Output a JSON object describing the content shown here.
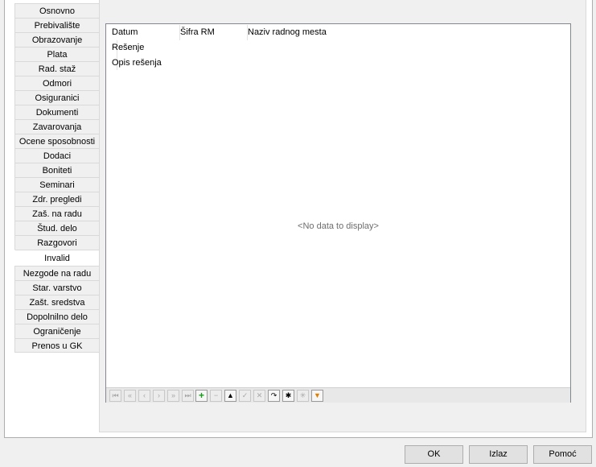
{
  "tabs": [
    {
      "label": "Osnovno",
      "active": false
    },
    {
      "label": "Prebivalište",
      "active": false
    },
    {
      "label": "Obrazovanje",
      "active": false
    },
    {
      "label": "Plata",
      "active": false
    },
    {
      "label": "Rad. staž",
      "active": false
    },
    {
      "label": "Odmori",
      "active": false
    },
    {
      "label": "Osiguranici",
      "active": false
    },
    {
      "label": "Dokumenti",
      "active": false
    },
    {
      "label": "Zavarovanja",
      "active": false
    },
    {
      "label": "Ocene sposobnosti",
      "active": false
    },
    {
      "label": "Dodaci",
      "active": false
    },
    {
      "label": "Boniteti",
      "active": false
    },
    {
      "label": "Seminari",
      "active": false
    },
    {
      "label": "Zdr. pregledi",
      "active": false
    },
    {
      "label": "Zaš. na radu",
      "active": false
    },
    {
      "label": "Štud. delo",
      "active": false
    },
    {
      "label": "Razgovori",
      "active": false
    },
    {
      "label": "Invalid",
      "active": true
    },
    {
      "label": "Nezgode na radu",
      "active": false
    },
    {
      "label": "Star. varstvo",
      "active": false
    },
    {
      "label": "Zašt. sredstva",
      "active": false
    },
    {
      "label": "Dopolnilno delo",
      "active": false
    },
    {
      "label": "Ograničenje",
      "active": false
    },
    {
      "label": "Prenos u GK",
      "active": false
    }
  ],
  "grid": {
    "columns": [
      "Datum",
      "Šifra RM",
      "Naziv radnog mesta"
    ],
    "row2_label": "Rešenje",
    "row3_label": "Opis rešenja",
    "empty_text": "<No data to display>"
  },
  "navigator": [
    {
      "icon": "first-icon",
      "glyph": "⏮",
      "enabled": false
    },
    {
      "icon": "prev-page-icon",
      "glyph": "«",
      "enabled": false
    },
    {
      "icon": "prev-icon",
      "glyph": "‹",
      "enabled": false
    },
    {
      "icon": "next-icon",
      "glyph": "›",
      "enabled": false
    },
    {
      "icon": "next-page-icon",
      "glyph": "»",
      "enabled": false
    },
    {
      "icon": "last-icon",
      "glyph": "⏭",
      "enabled": false
    },
    {
      "icon": "append-icon",
      "glyph": "+",
      "enabled": true
    },
    {
      "icon": "delete-icon",
      "glyph": "−",
      "enabled": false
    },
    {
      "icon": "edit-icon",
      "glyph": "▲",
      "enabled": true
    },
    {
      "icon": "post-icon",
      "glyph": "✓",
      "enabled": false
    },
    {
      "icon": "cancel-icon",
      "glyph": "✕",
      "enabled": false
    },
    {
      "icon": "refresh-icon",
      "glyph": "↷",
      "enabled": true
    },
    {
      "icon": "save-bookmark-icon",
      "glyph": "✱",
      "enabled": true
    },
    {
      "icon": "goto-bookmark-icon",
      "glyph": "✳",
      "enabled": false
    },
    {
      "icon": "filter-icon",
      "glyph": "▼",
      "enabled": true
    }
  ],
  "buttons": {
    "ok": "OK",
    "izlaz": "Izlaz",
    "pomoc": "Pomoć"
  }
}
